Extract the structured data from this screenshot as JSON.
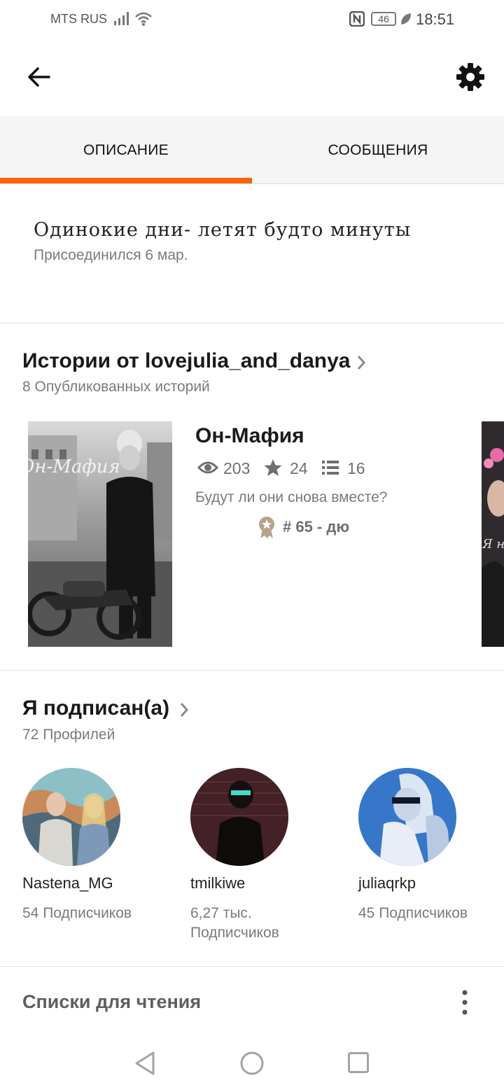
{
  "status_bar": {
    "carrier": "MTS RUS",
    "network": "46",
    "time": "18:51"
  },
  "tabs": [
    {
      "label": "ОПИСАНИЕ",
      "active": true
    },
    {
      "label": "СООБЩЕНИЯ",
      "active": false
    }
  ],
  "profile": {
    "description": "Одинокие дни- летят будто минуты",
    "joined": "Присоединился 6 мар."
  },
  "stories": {
    "title": "Истории от lovejulia_and_danya",
    "subtitle": "8 Опубликованных историй",
    "items": [
      {
        "title": "Он-Мафия",
        "reads": "203",
        "votes": "24",
        "parts": "16",
        "description": "Будут ли они снова вместе?",
        "rank": "# 65 - дю",
        "cover_text": "Он-Мафия"
      }
    ],
    "next_cover_text": "Я н"
  },
  "following": {
    "title": "Я подписан(а)",
    "subtitle": "72 Профилей",
    "profiles": [
      {
        "name": "Nastena_MG",
        "followers": "54 Подписчиков"
      },
      {
        "name": "tmilkiwe",
        "followers": "6,27 тыс. Подписчиков"
      },
      {
        "name": "juliaqrkp",
        "followers": "45 Подписчиков"
      }
    ]
  },
  "reading_lists": {
    "title": "Списки для чтения"
  },
  "colors": {
    "accent": "#ff6000",
    "tab_bg": "#f5f5f6",
    "muted_text": "#7a7a7a"
  },
  "icons": [
    "back-arrow-icon",
    "gear-icon",
    "eye-icon",
    "star-icon",
    "list-icon",
    "rank-badge-icon",
    "chevron-right-icon",
    "more-vert-icon",
    "nav-back-icon",
    "nav-home-icon",
    "nav-recents-icon"
  ]
}
